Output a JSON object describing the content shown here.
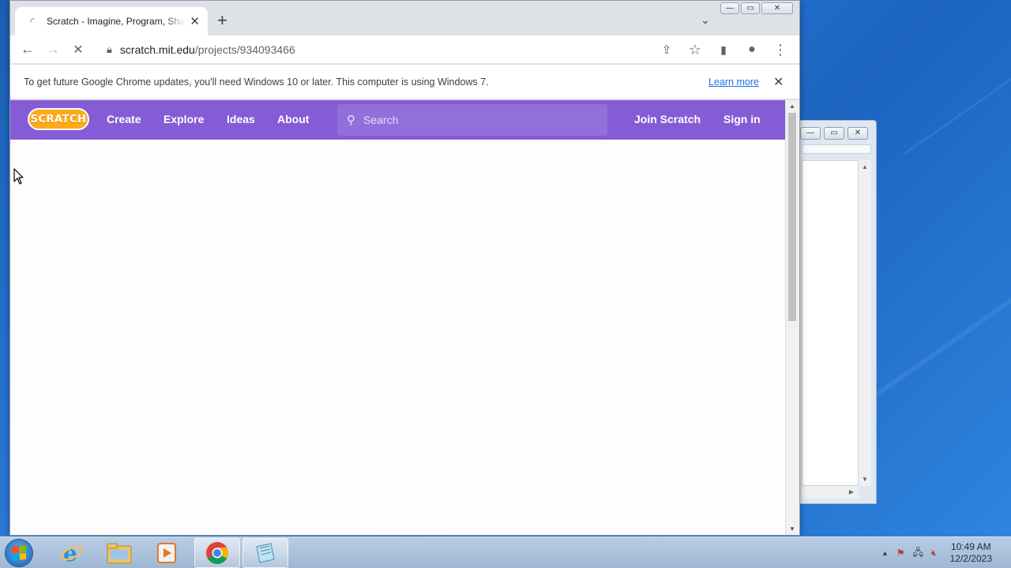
{
  "browser": {
    "tab": {
      "title": "Scratch - Imagine, Program, Share",
      "favicon": "loading-spinner-icon",
      "close_glyph": "✕"
    },
    "new_tab_glyph": "+",
    "tab_search_glyph": "⌄",
    "window_buttons": {
      "minimize": "—",
      "maximize": "▭",
      "close": "✕"
    },
    "nav": {
      "back": "←",
      "forward": "→",
      "stop": "✕"
    },
    "address": {
      "host": "scratch.mit.edu",
      "path": "/projects/934093466"
    },
    "toolbar_right": {
      "share": "⇪",
      "bookmark": "☆",
      "side_panel": "▮",
      "profile": "●",
      "menu": "⋮"
    }
  },
  "infobar": {
    "message": "To get future Google Chrome updates, you'll need Windows 10 or later. This computer is using Windows 7.",
    "link": "Learn more",
    "close": "✕"
  },
  "scratch": {
    "logo_text": "SCRATCH",
    "nav": [
      "Create",
      "Explore",
      "Ideas",
      "About"
    ],
    "search_placeholder": "Search",
    "join": "Join Scratch",
    "signin": "Sign in",
    "brand_color": "#855cd6",
    "logo_color": "#ffab19"
  },
  "taskbar": {
    "apps": [
      "internet-explorer-icon",
      "file-explorer-icon",
      "media-player-icon",
      "chrome-icon",
      "notepad-icon"
    ],
    "time": "10:49 AM",
    "date": "12/2/2023",
    "tray_up": "▲"
  }
}
